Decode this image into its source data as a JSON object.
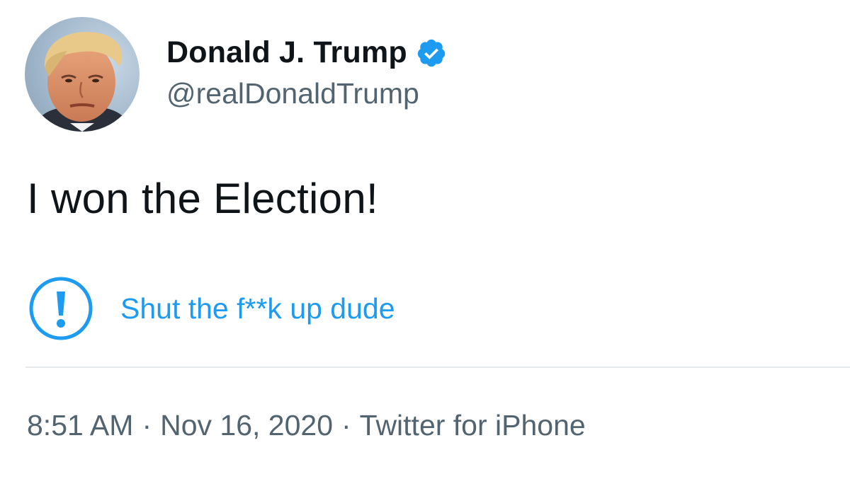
{
  "author": {
    "display_name": "Donald J. Trump",
    "handle": "@realDonaldTrump",
    "verified": true,
    "verified_color": "#1d9bf0"
  },
  "tweet": {
    "text": "I won the Election!"
  },
  "notice": {
    "icon": "exclamation-circle-icon",
    "text": "Shut the f**k up dude",
    "color": "#1d9bf0"
  },
  "meta": {
    "time": "8:51 AM",
    "separator": "·",
    "date": "Nov 16, 2020",
    "source": "Twitter for iPhone"
  }
}
